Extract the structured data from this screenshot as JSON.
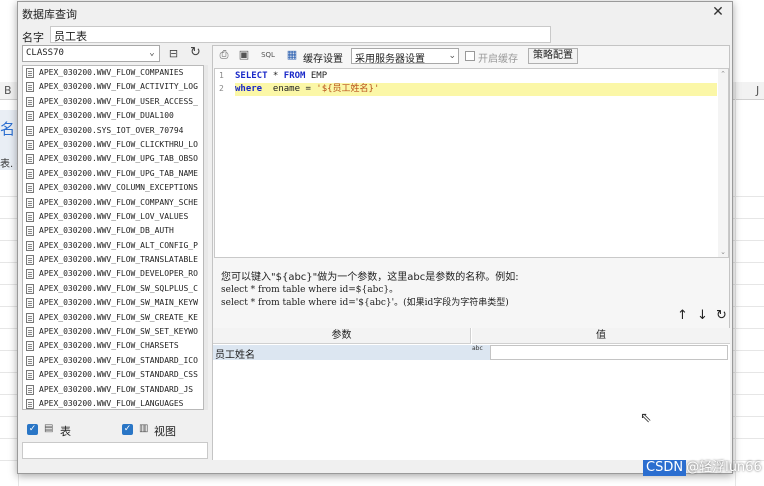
{
  "background": {
    "column_labels": [
      "B",
      "J"
    ],
    "left_fragments": [
      "名",
      "表. G"
    ]
  },
  "dialog": {
    "title": "数据库查询",
    "close_icon": "close-icon",
    "name_label": "名字",
    "name_value": "员工表"
  },
  "left_panel": {
    "schema": "CLASS70",
    "tables": [
      "APEX_030200.WWV_FLOW_COMPANIES",
      "APEX_030200.WWV_FLOW_ACTIVITY_LOG",
      "APEX_030200.WWV_FLOW_USER_ACCESS_",
      "APEX_030200.WWV_FLOW_DUAL100",
      "APEX_030200.SYS_IOT_OVER_70794",
      "APEX_030200.WWV_FLOW_CLICKTHRU_LO",
      "APEX_030200.WWV_FLOW_UPG_TAB_OBSO",
      "APEX_030200.WWV_FLOW_UPG_TAB_NAME",
      "APEX_030200.WWV_COLUMN_EXCEPTIONS",
      "APEX_030200.WWV_FLOW_COMPANY_SCHE",
      "APEX_030200.WWV_FLOW_LOV_VALUES",
      "APEX_030200.WWV_FLOW_DB_AUTH",
      "APEX_030200.WWV_FLOW_ALT_CONFIG_P",
      "APEX_030200.WWV_FLOW_TRANSLATABLE",
      "APEX_030200.WWV_FLOW_DEVELOPER_RO",
      "APEX_030200.WWV_FLOW_SW_SQLPLUS_C",
      "APEX_030200.WWV_FLOW_SW_MAIN_KEYW",
      "APEX_030200.WWV_FLOW_SW_CREATE_KE",
      "APEX_030200.WWV_FLOW_SW_SET_KEYWO",
      "APEX_030200.WWV_FLOW_CHARSETS",
      "APEX_030200.WWV_FLOW_STANDARD_ICO",
      "APEX_030200.WWV_FLOW_STANDARD_CSS",
      "APEX_030200.WWV_FLOW_STANDARD_JS",
      "APEX_030200.WWV_FLOW_LANGUAGES"
    ],
    "table_checkbox_label": "表",
    "view_checkbox_label": "视图",
    "table_checked": true,
    "view_checked": true
  },
  "toolbar": {
    "cache_label": "缓存设置",
    "cache_value": "采用服务器设置",
    "enable_cache_label": "开启缓存",
    "strategy_button": "策略配置"
  },
  "editor": {
    "line_numbers": [
      "1",
      "2"
    ],
    "line1": {
      "kw1": "SELECT",
      "plain1": " * ",
      "kw2": "FROM",
      "plain2": " EMP"
    },
    "line2": {
      "kw1": "where",
      "plain1": "  ename = ",
      "str": "'${员工姓名}'"
    }
  },
  "help": {
    "line1": "您可以键入\"${abc}\"做为一个参数，这里abc是参数的名称。例如:",
    "line2": "select * from table where id=${abc}。",
    "line3": "select * from table where id='${abc}'。(如果id字段为字符串类型)"
  },
  "params": {
    "header_param": "参数",
    "header_value": "值",
    "rows": [
      {
        "name": "员工姓名",
        "type_label": "abc",
        "value": ""
      }
    ]
  },
  "watermark": {
    "brand": "CSDN",
    "user": "@轻浮lun66"
  },
  "colors": {
    "accent": "#2a76c6",
    "keyword": "#1a29c8",
    "string": "#b8521b",
    "highlight": "#fbf7a7",
    "selected_row": "#dce6f1"
  }
}
